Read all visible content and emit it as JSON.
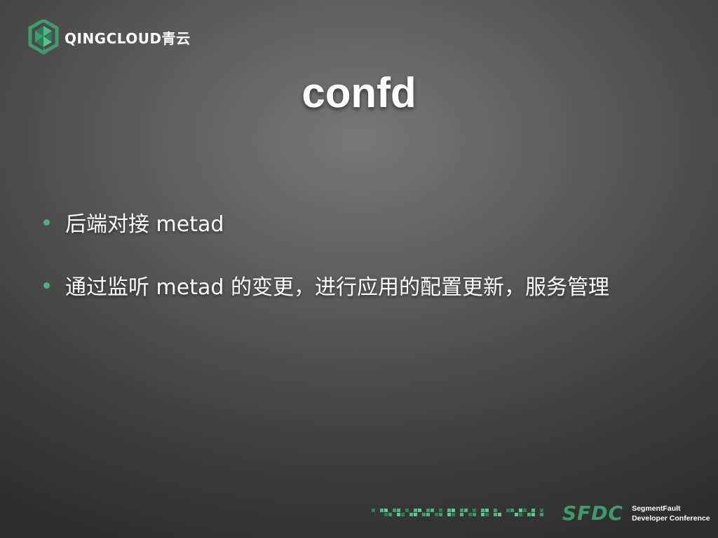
{
  "header": {
    "logo_text": "QINGCLOUD青云"
  },
  "slide": {
    "title": "confd",
    "bullets": [
      "后端对接 metad",
      "通过监听 metad 的变更，进行应用的配置更新，服务管理"
    ]
  },
  "footer": {
    "sfdc_label": "SFDC",
    "org_line1": "SegmentFault",
    "org_line2": "Developer Conference"
  },
  "colors": {
    "accent_green": "#4caf7d",
    "brand_green": "#3e9b6e",
    "text": "#ffffff"
  },
  "icons": {
    "company_logo": "qingcloud-hexagon-icon",
    "bullet": "bullet-dot-icon",
    "footer_band": "pixel-pattern-icon"
  }
}
